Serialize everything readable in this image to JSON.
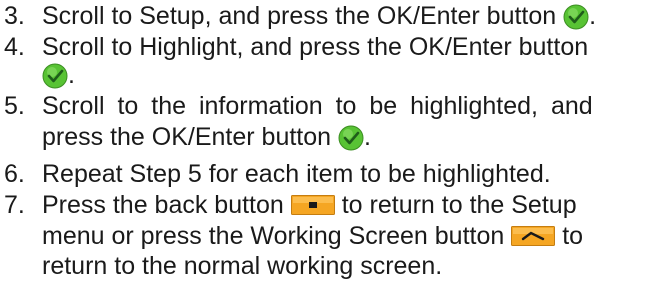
{
  "steps": [
    {
      "number": "3.",
      "lines": [
        "Scroll to Setup, and press the OK/Enter button",
        "."
      ],
      "icon": "ok-enter-button-icon"
    },
    {
      "number": "4.",
      "lines": [
        "Scroll to Highlight, and press the OK/Enter button",
        "."
      ],
      "icon": "ok-enter-button-icon"
    },
    {
      "number": "5.",
      "lines": [
        "Scroll to the information to be highlighted, and",
        "press the OK/Enter button",
        "."
      ],
      "icon": "ok-enter-button-icon"
    },
    {
      "number": "6.",
      "lines": [
        "Repeat Step 5 for each item to be highlighted."
      ]
    },
    {
      "number": "7.",
      "lines": [
        "Press the back button",
        "to return to the Setup",
        "menu or press the Working Screen button",
        "to",
        "return to the normal working screen."
      ],
      "icons": [
        "back-button-icon",
        "working-screen-button-icon"
      ]
    }
  ],
  "colors": {
    "text": "#1a1a1a",
    "check_green": "#58c334",
    "check_mark": "#1f5d1a",
    "button_orange": "#f5a623"
  }
}
